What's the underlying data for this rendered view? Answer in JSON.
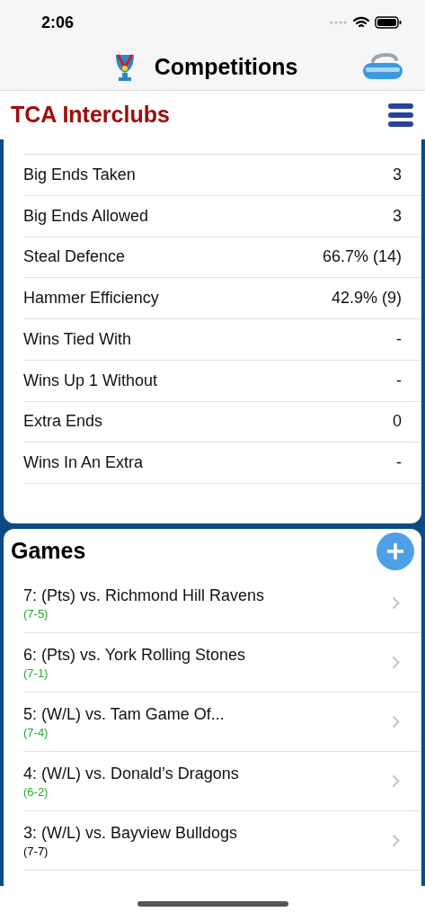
{
  "status_bar": {
    "time": "2:06"
  },
  "nav": {
    "title": "Competitions"
  },
  "header": {
    "title": "TCA Interclubs"
  },
  "stats": [
    {
      "label": "Big Ends Taken",
      "value": "3"
    },
    {
      "label": "Big Ends Allowed",
      "value": "3"
    },
    {
      "label": "Steal Defence",
      "value": "66.7% (14)"
    },
    {
      "label": "Hammer Efficiency",
      "value": "42.9% (9)"
    },
    {
      "label": "Wins Tied With",
      "value": "-"
    },
    {
      "label": "Wins Up 1 Without",
      "value": "-"
    },
    {
      "label": "Extra Ends",
      "value": "0"
    },
    {
      "label": "Wins In An Extra",
      "value": "-"
    }
  ],
  "games": {
    "title": "Games",
    "items": [
      {
        "title": "7: (Pts) vs. Richmond Hill Ravens",
        "score": "(7-5)",
        "kind": "win"
      },
      {
        "title": "6: (Pts) vs. York Rolling Stones",
        "score": "(7-1)",
        "kind": "win"
      },
      {
        "title": "5: (W/L) vs. Tam Game Of...",
        "score": "(7-4)",
        "kind": "win"
      },
      {
        "title": "4: (W/L) vs. Donald’s Dragons",
        "score": "(6-2)",
        "kind": "win"
      },
      {
        "title": "3: (W/L) vs. Bayview Bulldogs",
        "score": "(7-7)",
        "kind": "tie"
      }
    ]
  }
}
